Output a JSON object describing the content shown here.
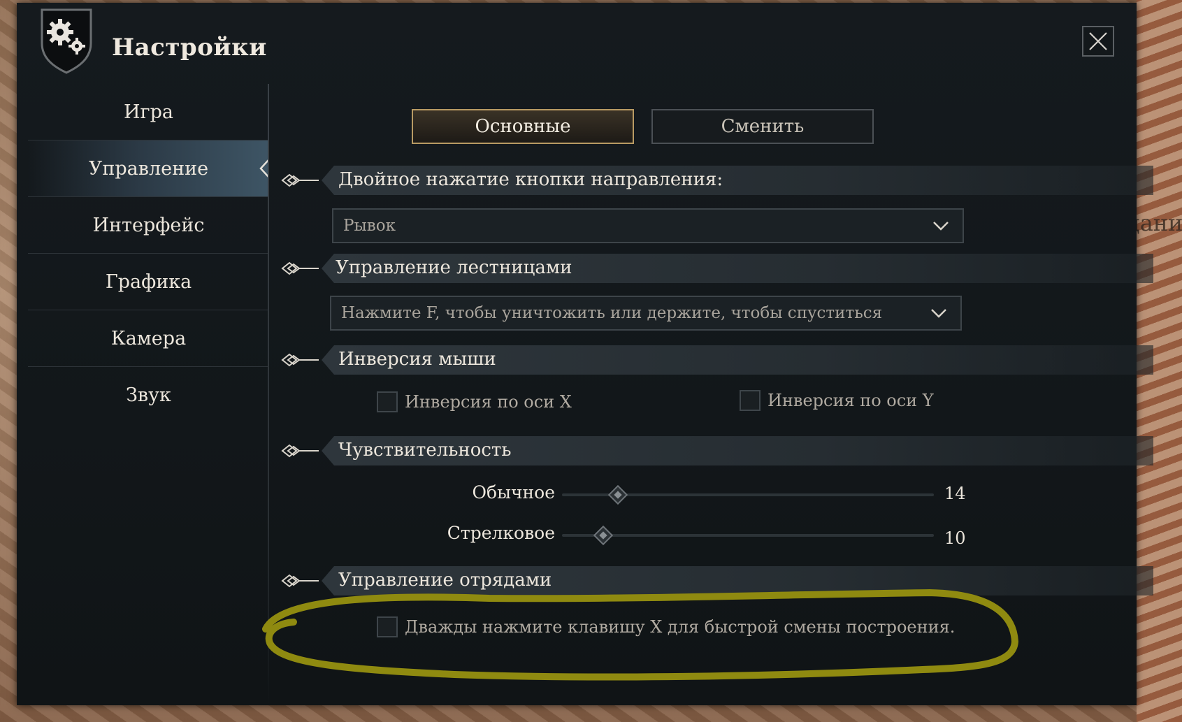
{
  "window": {
    "title": "Настройки",
    "close_icon": "close-icon",
    "logo_icon": "gear-shield-icon"
  },
  "background": {
    "side_text": "Задания"
  },
  "sidebar": {
    "items": [
      {
        "label": "Игра",
        "active": false
      },
      {
        "label": "Управление",
        "active": true
      },
      {
        "label": "Интерфейс",
        "active": false
      },
      {
        "label": "Графика",
        "active": false
      },
      {
        "label": "Камера",
        "active": false
      },
      {
        "label": "Звук",
        "active": false
      }
    ]
  },
  "tabs": [
    {
      "label": "Основные",
      "active": true
    },
    {
      "label": "Сменить",
      "active": false
    }
  ],
  "sections": {
    "double_tap": {
      "title": "Двойное нажатие кнопки направления:",
      "dropdown_value": "Рывок"
    },
    "ladder": {
      "title": "Управление лестницами",
      "dropdown_value": "Нажмите F, чтобы уничтожить или держите, чтобы спуститься"
    },
    "mouse_invert": {
      "title": "Инверсия мыши",
      "invert_x": {
        "label": "Инверсия по оси X",
        "checked": false
      },
      "invert_y": {
        "label": "Инверсия по оси Y",
        "checked": false
      }
    },
    "sensitivity": {
      "title": "Чувствительность",
      "normal": {
        "label": "Обычное",
        "value": "14",
        "fraction": 0.15
      },
      "aim": {
        "label": "Стрелковое",
        "value": "10",
        "fraction": 0.11
      }
    },
    "squads": {
      "title": "Управление отрядами",
      "double_tap_x": {
        "label": "Дважды нажмите клавишу X для быстрой смены построения.",
        "checked": false
      }
    }
  },
  "colors": {
    "panel_bg": "#12171a",
    "accent_gold": "#b89a63",
    "highlight_ellipse": "#8f8a10"
  }
}
